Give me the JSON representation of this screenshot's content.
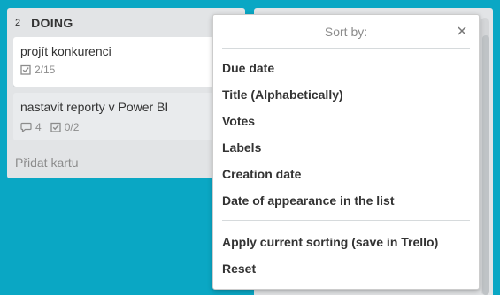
{
  "list": {
    "count": "2",
    "title": "DOING",
    "cards": [
      {
        "title": "projít konkurenci",
        "checklist": "2/15"
      },
      {
        "title": "nastavit reporty v Power BI",
        "comments": "4",
        "checklist": "0/2"
      }
    ],
    "add_card_label": "Přidat kartu"
  },
  "popover": {
    "title": "Sort by:",
    "items": [
      "Due date",
      "Title (Alphabetically)",
      "Votes",
      "Labels",
      "Creation date",
      "Date of appearance in the list"
    ],
    "actions": [
      "Apply current sorting (save in Trello)",
      "Reset"
    ]
  },
  "colors": {
    "board_background": "#0aa7c4",
    "list_background": "#e2e4e6",
    "text": "#333333",
    "muted": "#8c8c8c"
  },
  "icons": {
    "checklist": "checklist-icon",
    "comment": "comment-icon",
    "sync": "sync-icon",
    "close": "close-icon"
  }
}
